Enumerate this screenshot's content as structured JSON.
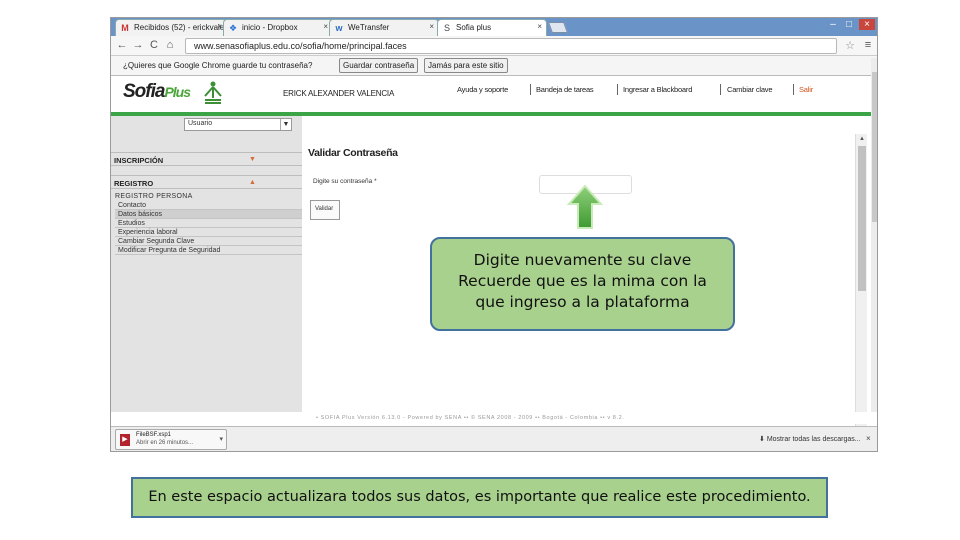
{
  "browser": {
    "tabs": [
      {
        "label": "Recibidos (52) - erickvalen",
        "icon": "gmail-icon",
        "close": "×"
      },
      {
        "label": "inicio - Dropbox",
        "icon": "dropbox-icon",
        "close": "×"
      },
      {
        "label": "WeTransfer",
        "icon": "wetransfer-icon",
        "close": "×"
      },
      {
        "label": "Sofia plus",
        "icon": "sofia-icon",
        "close": "×"
      }
    ],
    "window_controls": {
      "minimize": "–",
      "maximize": "□",
      "close": "×"
    },
    "nav": {
      "back": "←",
      "forward": "→",
      "reload": "C",
      "home": "⌂"
    },
    "url": "www.senasofiaplus.edu.co/sofia/home/principal.faces",
    "infobar": {
      "message": "¿Quieres que Google Chrome guarde tu contraseña?",
      "save_button": "Guardar contraseña",
      "never_button": "Jamás para este sitio"
    }
  },
  "site": {
    "logo_text": "Sofia",
    "logo_plus": "Plus",
    "username": "ERICK ALEXANDER VALENCIA",
    "topnav": [
      "Ayuda y soporte",
      "Bandeja de tareas",
      "Ingresar a Blackboard",
      "Cambiar clave",
      "Salir"
    ],
    "role_select": "Usuario",
    "menu": {
      "inscripcion": "INSCRIPCIÓN",
      "registro": "REGISTRO",
      "registro_persona": "REGISTRO PERSONA",
      "items": [
        "Contacto",
        "Datos básicos",
        "Estudios",
        "Experiencia laboral",
        "Cambiar Segunda Clave",
        "Modificar Pregunta de Seguridad"
      ],
      "active_index": 1
    },
    "content": {
      "title": "Validar Contraseña",
      "field_label": "Digite su contraseña",
      "field_required": "*",
      "validate_button": "Validar"
    },
    "footer": "• SOFIA Plus Versión 6.13.0 - Powered by SENA •• © SENA 2008 - 2009 •• Bogotá - Colombia •• v 8.2."
  },
  "downloads": {
    "file_name": "FileBSF.xsp1",
    "status": "Abrir en 26 minutos...",
    "show_all": "Mostrar todas las descargas...",
    "close": "×"
  },
  "callout": {
    "lines": [
      "Digite nuevamente su clave",
      "Recuerde que es la mima con la",
      "que ingreso a la plataforma"
    ]
  },
  "bottom_note": "En este espacio actualizara todos sus datos, es importante que realice este procedimiento.",
  "colors": {
    "callout_fill": "#a9d18e",
    "callout_border": "#41719c",
    "sena_green": "#3aa446",
    "salir": "#d2531f"
  }
}
